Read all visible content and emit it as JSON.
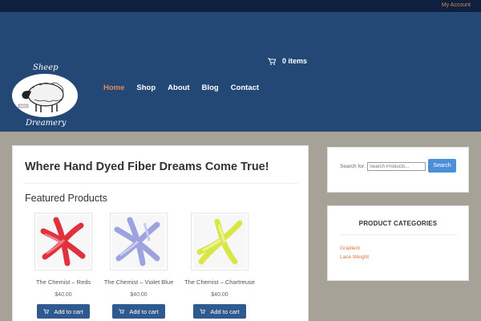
{
  "topbar": {
    "account_link": "My Account"
  },
  "logo": {
    "line1": "Sheep",
    "line2": "Dreamery"
  },
  "nav": {
    "items": [
      {
        "label": "Home",
        "active": true
      },
      {
        "label": "Shop"
      },
      {
        "label": "About"
      },
      {
        "label": "Blog"
      },
      {
        "label": "Contact"
      }
    ]
  },
  "cart": {
    "label": "0 items",
    "icon": "cart-icon"
  },
  "main": {
    "title": "Where Hand Dyed Fiber Dreams Come True!",
    "featured_heading": "Featured Products",
    "products": [
      {
        "name": "The Chemist – Reds",
        "price": "$40.00",
        "button": "Add to cart",
        "color": "#e0323c"
      },
      {
        "name": "The Chemist – Violet Blue",
        "price": "$40.00",
        "button": "Add to cart",
        "color": "#9ea3e0"
      },
      {
        "name": "The Chemist – Chartreuse",
        "price": "$40.00",
        "button": "Add to cart",
        "color": "#d8e646"
      }
    ]
  },
  "search_widget": {
    "label": "Search for:",
    "placeholder": "Search Products...",
    "button": "Search"
  },
  "categories_widget": {
    "title": "PRODUCT CATEGORIES",
    "items": [
      "Gradient",
      "Lace Weight"
    ]
  },
  "colors": {
    "header": "#234876",
    "topbar": "#0e1f3f",
    "accent": "#e2895a",
    "button": "#2e5a8f",
    "link": "#d9763e"
  }
}
